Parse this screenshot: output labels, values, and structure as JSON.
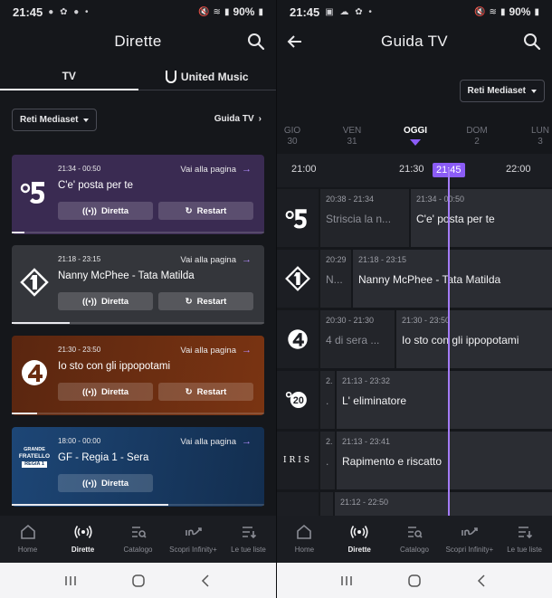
{
  "status": {
    "time": "21:45",
    "battery": "90%"
  },
  "left": {
    "title": "Dirette",
    "tabs": [
      "TV",
      "United Music"
    ],
    "network_dropdown": "Reti Mediaset",
    "guide_link": "Guida TV",
    "cards": [
      {
        "channel_icon": "canale5-logo-icon",
        "time": "21:34 - 00:50",
        "goto": "Vai alla pagina",
        "program": "C'e' posta per te",
        "live_label": "Diretta",
        "restart_label": "Restart",
        "bg": "#3a2b52",
        "progress": 0.05
      },
      {
        "channel_icon": "italia1-logo-icon",
        "time": "21:18 - 23:15",
        "goto": "Vai alla pagina",
        "program": "Nanny McPhee - Tata Matilda",
        "live_label": "Diretta",
        "restart_label": "Restart",
        "bg": "#34363b",
        "progress": 0.23
      },
      {
        "channel_icon": "rete4-logo-icon",
        "time": "21:30 - 23:50",
        "goto": "Vai alla pagina",
        "program": "Io sto con gli ippopotami",
        "live_label": "Diretta",
        "restart_label": "Restart",
        "bg": "#6b2c10",
        "progress": 0.1
      },
      {
        "channel_icon": "grande-fratello-logo-icon",
        "logo_text": [
          "GRANDE",
          "FRATELLO",
          "REGIA 1"
        ],
        "time": "18:00 - 00:00",
        "goto": "Vai alla pagina",
        "program": "GF - Regia 1 - Sera",
        "live_label": "Diretta",
        "restart_label": "",
        "bg": "#173a63",
        "progress": 0.62
      }
    ]
  },
  "nav": {
    "items": [
      {
        "label": "Home",
        "icon": "home-icon"
      },
      {
        "label": "Dirette",
        "icon": "broadcast-icon"
      },
      {
        "label": "Catalogo",
        "icon": "catalog-icon"
      },
      {
        "label": "Scopri Infinity+",
        "icon": "infinity-icon"
      },
      {
        "label": "Le tue liste",
        "icon": "list-icon"
      }
    ]
  },
  "right": {
    "title": "Guida TV",
    "network_dropdown": "Reti Mediaset",
    "days": [
      {
        "name": "GIO",
        "num": "30"
      },
      {
        "name": "VEN",
        "num": "31"
      },
      {
        "name": "OGGI",
        "num": ""
      },
      {
        "name": "DOM",
        "num": "2"
      },
      {
        "name": "LUN",
        "num": "3"
      }
    ],
    "timeline": {
      "t1": "21:00",
      "t2": "21:30",
      "now": "21:45",
      "t3": "22:00"
    },
    "rows": [
      {
        "icon": "canale5-logo-icon",
        "cells": [
          {
            "time": "20:38 - 21:34",
            "prog": "Striscia la n...",
            "kind": "past"
          },
          {
            "time": "21:34 - 00:50",
            "prog": "C'e' posta per te",
            "kind": "cur"
          }
        ]
      },
      {
        "icon": "italia1-logo-icon",
        "cells": [
          {
            "time": "20:29",
            "prog": "N...",
            "kind": "past"
          },
          {
            "time": "21:18 - 23:15",
            "prog": "Nanny McPhee - Tata Matilda",
            "kind": "cur"
          }
        ]
      },
      {
        "icon": "rete4-logo-icon",
        "cells": [
          {
            "time": "20:30 - 21:30",
            "prog": "4 di sera ...",
            "kind": "past"
          },
          {
            "time": "21:30 - 23:50",
            "prog": "Io sto con gli ippopotami",
            "kind": "cur"
          }
        ]
      },
      {
        "icon": "20-logo-icon",
        "cells": [
          {
            "time": "2.",
            "prog": ".",
            "kind": "past"
          },
          {
            "time": "21:13 - 23:32",
            "prog": "L' eliminatore",
            "kind": "cur"
          }
        ]
      },
      {
        "icon": "iris-logo-icon",
        "logo_text": "IRIS",
        "cells": [
          {
            "time": "2.",
            "prog": ".",
            "kind": "past"
          },
          {
            "time": "21:13 - 23:41",
            "prog": "Rapimento e riscatto",
            "kind": "cur"
          }
        ]
      },
      {
        "icon": "channel-logo-icon",
        "cells": [
          {
            "time": "",
            "prog": "",
            "kind": "past"
          },
          {
            "time": "21:12 - 22:50",
            "prog": "",
            "kind": "cur"
          }
        ]
      }
    ]
  }
}
